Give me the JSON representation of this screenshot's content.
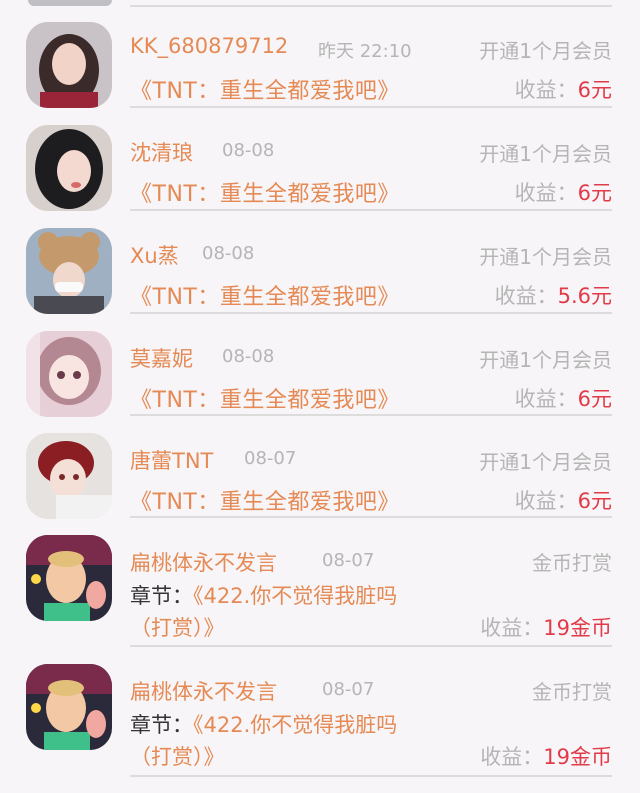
{
  "colors": {
    "accent": "#e58a55",
    "earn_value": "#e23a48",
    "muted": "#b5b5b5"
  },
  "records": [
    {
      "name": "KK_680879712",
      "date": "昨天 22:10",
      "type": "开通1个月会员",
      "title": "《TNT：重生全都爱我吧》",
      "earn_label": "收益：",
      "earn_value": "6元"
    },
    {
      "name": "沈清琅",
      "date": "08-08",
      "type": "开通1个月会员",
      "title": "《TNT：重生全都爱我吧》",
      "earn_label": "收益：",
      "earn_value": "6元"
    },
    {
      "name": "Xu蒸",
      "date": "08-08",
      "type": "开通1个月会员",
      "title": "《TNT：重生全都爱我吧》",
      "earn_label": "收益：",
      "earn_value": "5.6元"
    },
    {
      "name": "莫嘉妮",
      "date": "08-08",
      "type": "开通1个月会员",
      "title": "《TNT：重生全都爱我吧》",
      "earn_label": "收益：",
      "earn_value": "6元"
    },
    {
      "name": "唐蕾TNT",
      "date": "08-07",
      "type": "开通1个月会员",
      "title": "《TNT：重生全都爱我吧》",
      "earn_label": "收益：",
      "earn_value": "6元"
    },
    {
      "name": "扁桃体永不发言",
      "date": "08-07",
      "type": "金币打赏",
      "chapter_label": "章节：",
      "chapter_title": "《422.你不觉得我脏吗",
      "chapter_cont": "（打赏）》",
      "earn_label": "收益：",
      "earn_value": "19金币"
    },
    {
      "name": "扁桃体永不发言",
      "date": "08-07",
      "type": "金币打赏",
      "chapter_label": "章节：",
      "chapter_title": "《422.你不觉得我脏吗",
      "chapter_cont": "（打赏）》",
      "earn_label": "收益：",
      "earn_value": "19金币"
    }
  ]
}
